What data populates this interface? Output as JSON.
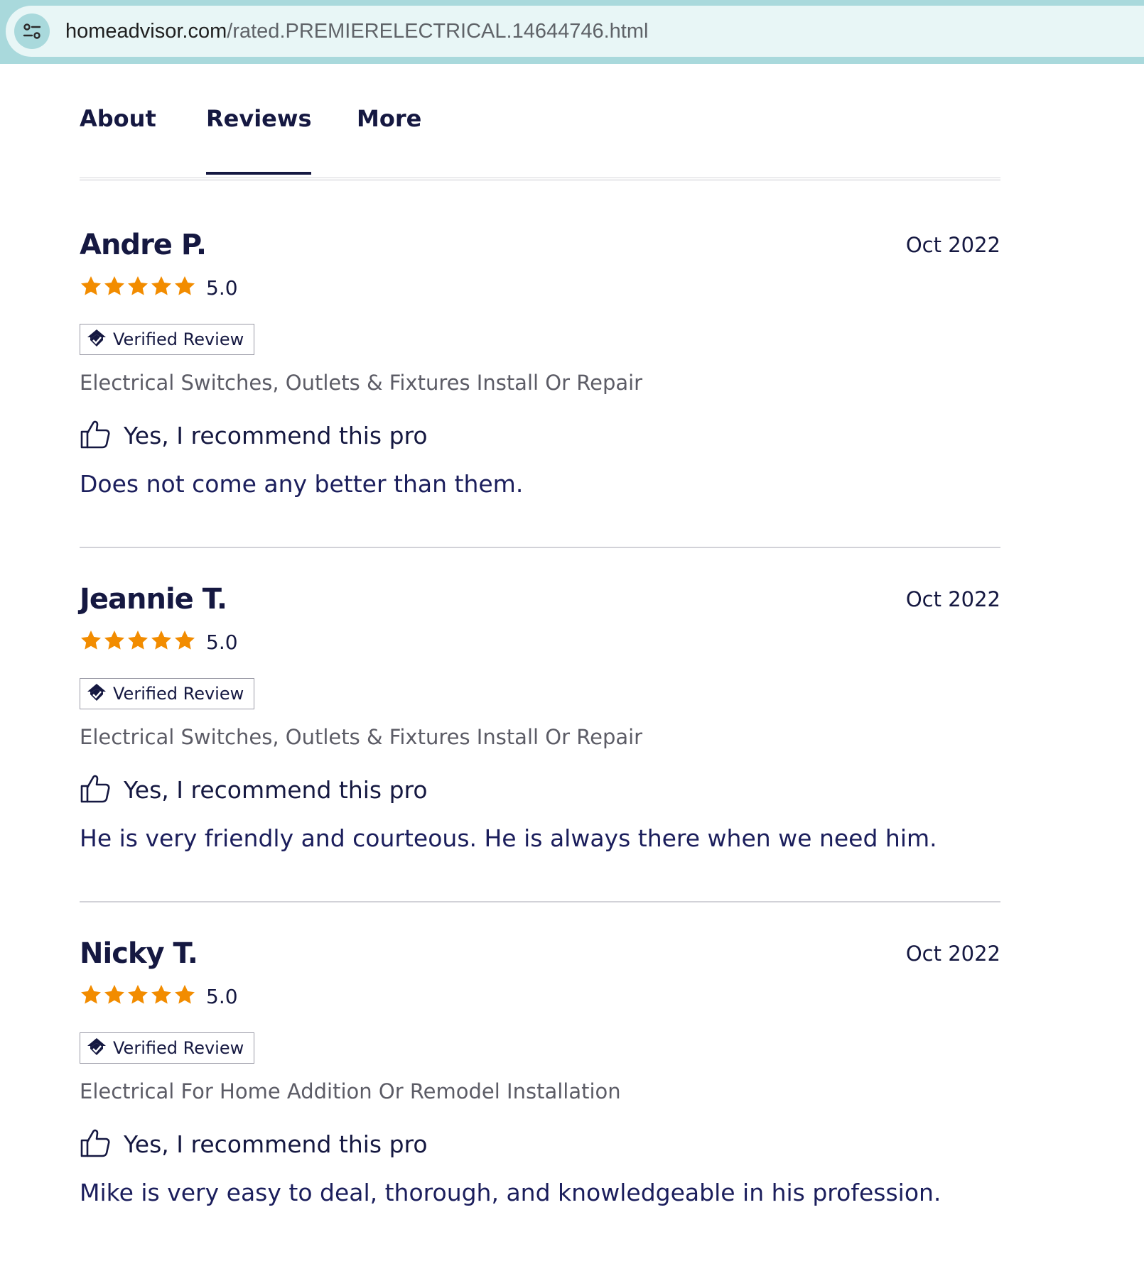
{
  "browser": {
    "url_domain": "homeadvisor.com",
    "url_path": "/rated.PREMIERELECTRICAL.14644746.html",
    "site_info_icon": "tune-icon"
  },
  "tabs": [
    {
      "label": "About",
      "active": false
    },
    {
      "label": "Reviews",
      "active": true
    },
    {
      "label": "More",
      "active": false
    }
  ],
  "colors": {
    "star": "#f28c00",
    "text": "#151841",
    "address_bar": "#a9d9dc"
  },
  "reviews": [
    {
      "name": "Andre P.",
      "date": "Oct 2022",
      "rating": "5.0",
      "stars_filled": 5,
      "badge": "Verified Review",
      "service": "Electrical Switches, Outlets & Fixtures Install Or Repair",
      "recommend": "Yes, I recommend this pro",
      "text": "Does not come any better than them."
    },
    {
      "name": "Jeannie T.",
      "date": "Oct 2022",
      "rating": "5.0",
      "stars_filled": 5,
      "badge": "Verified Review",
      "service": "Electrical Switches, Outlets & Fixtures Install Or Repair",
      "recommend": "Yes, I recommend this pro",
      "text": "He is very friendly and courteous. He is always there when we need him."
    },
    {
      "name": "Nicky T.",
      "date": "Oct 2022",
      "rating": "5.0",
      "stars_filled": 5,
      "badge": "Verified Review",
      "service": "Electrical For Home Addition Or Remodel Installation",
      "recommend": "Yes, I recommend this pro",
      "text": "Mike is very easy to deal, thorough, and knowledgeable in his profession."
    }
  ]
}
